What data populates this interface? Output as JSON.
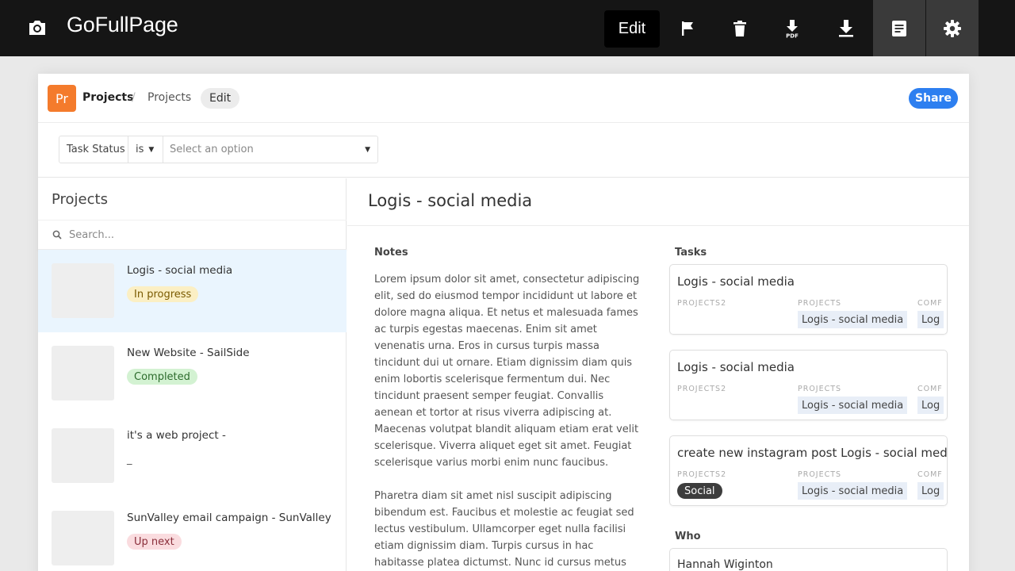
{
  "extension": {
    "title": "GoFullPage",
    "edit_label": "Edit",
    "icons": [
      "camera-icon",
      "flag-icon",
      "trash-icon",
      "pdf-download-icon",
      "download-icon",
      "document-icon",
      "gear-icon"
    ]
  },
  "topbar": {
    "app_badge": "Pr",
    "crumb_1": "Projects",
    "crumb_sep": "/",
    "crumb_2": "Projects",
    "edit_label": "Edit",
    "share_label": "Share"
  },
  "filter": {
    "field": "Task Status",
    "operator": "is",
    "placeholder": "Select an option"
  },
  "list": {
    "title": "Projects",
    "search_placeholder": "Search...",
    "items": [
      {
        "title": "Logis - social media",
        "status": "In progress"
      },
      {
        "title": "New Website - SailSide",
        "status": "Completed"
      },
      {
        "title": "it's a web project -",
        "status": "_"
      },
      {
        "title": "SunValley email campaign - SunValley",
        "status": "Up next"
      }
    ]
  },
  "detail": {
    "title": "Logis - social media",
    "notes_label": "Notes",
    "notes_text": "Lorem ipsum dolor sit amet, consectetur adipiscing elit, sed do eiusmod tempor incididunt ut labore et dolore magna aliqua. Et netus et malesuada fames ac turpis egestas maecenas. Enim sit amet venenatis urna. Eros in cursus turpis massa tincidunt dui ut ornare. Etiam dignissim diam quis enim lobortis scelerisque fermentum dui. Nec tincidunt praesent semper feugiat. Convallis aenean et tortor at risus viverra adipiscing at. Maecenas volutpat blandit aliquam etiam erat velit scelerisque. Viverra aliquet eget sit amet. Feugiat scelerisque varius morbi enim nunc faucibus.\n\nPharetra diam sit amet nisl suscipit adipiscing bibendum est. Faucibus et molestie ac feugiat sed lectus vestibulum. Ullamcorper eget nulla facilisi etiam dignissim diam. Turpis cursus in hac habitasse platea dictumst. Nunc id cursus metus aliquam",
    "tasks_label": "Tasks",
    "tasks": [
      {
        "name": "Logis - social media",
        "col1_header": "PROJECTS2",
        "col1_value": "",
        "col2_header": "PROJECTS",
        "col2_value": "Logis - social media",
        "col3_header": "COMF",
        "col3_value": "Log"
      },
      {
        "name": "Logis - social media",
        "col1_header": "PROJECTS2",
        "col1_value": "",
        "col2_header": "PROJECTS",
        "col2_value": "Logis - social media",
        "col3_header": "COMF",
        "col3_value": "Log"
      },
      {
        "name": "create new instagram post Logis - social media",
        "col1_header": "PROJECTS2",
        "col1_value": "Social",
        "col2_header": "PROJECTS",
        "col2_value": "Logis - social media",
        "col3_header": "COMF",
        "col3_value": "Log"
      }
    ],
    "who_label": "Who",
    "who_name": "Hannah Wiginton"
  },
  "colors": {
    "toolbar_bg": "#151515",
    "app_badge": "#f47b2c",
    "share": "#2d7ff0",
    "selected_row": "#eaf5fe",
    "pill_in_progress": "#fbefc4",
    "pill_completed": "#d3f2d2",
    "pill_up_next": "#fadcdf"
  }
}
